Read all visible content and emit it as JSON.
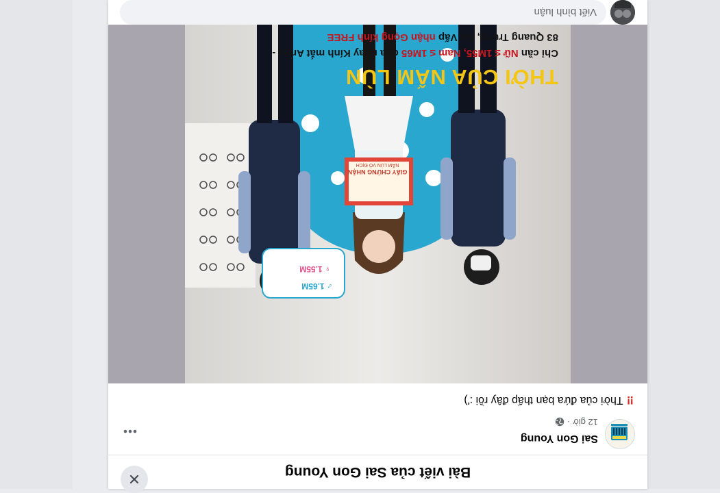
{
  "modal": {
    "title": "Bài viết của Sai Gon Young",
    "close_icon": "close-icon"
  },
  "post": {
    "author": "Sai Gon Young",
    "time": "12 giờ",
    "separator": "·",
    "privacy_icon": "globe-icon",
    "more_icon": "more-horizontal-icon",
    "text_emoji": "!!",
    "text": "Thời của đứa bạn thấp đây rồi :')"
  },
  "photo": {
    "headline": "THỜI CỦA NẤM LÙN",
    "line1_prefix": "Chỉ cần",
    "line1_female": "Nữ ≤ 1M55, Nam ≤ 1M65",
    "line1_suffix": "qua ngay Kính mắt Anna -",
    "line2_prefix": "83 Quang Trung, Gò Vấp",
    "line2_highlight": "nhận Gọng kính FREE",
    "certificate_title": "GIẤY CHỨNG NHẬN",
    "certificate_sub": "NẤM LÙN VÔ ĐỊCH",
    "height_male": "♂ 1.65M",
    "height_female": "♀ 1.55M"
  },
  "comment": {
    "placeholder": "Viết bình luận"
  },
  "colors": {
    "headline": "#f3c515",
    "accent_red": "#e02424",
    "bg": "#e9ebee"
  }
}
